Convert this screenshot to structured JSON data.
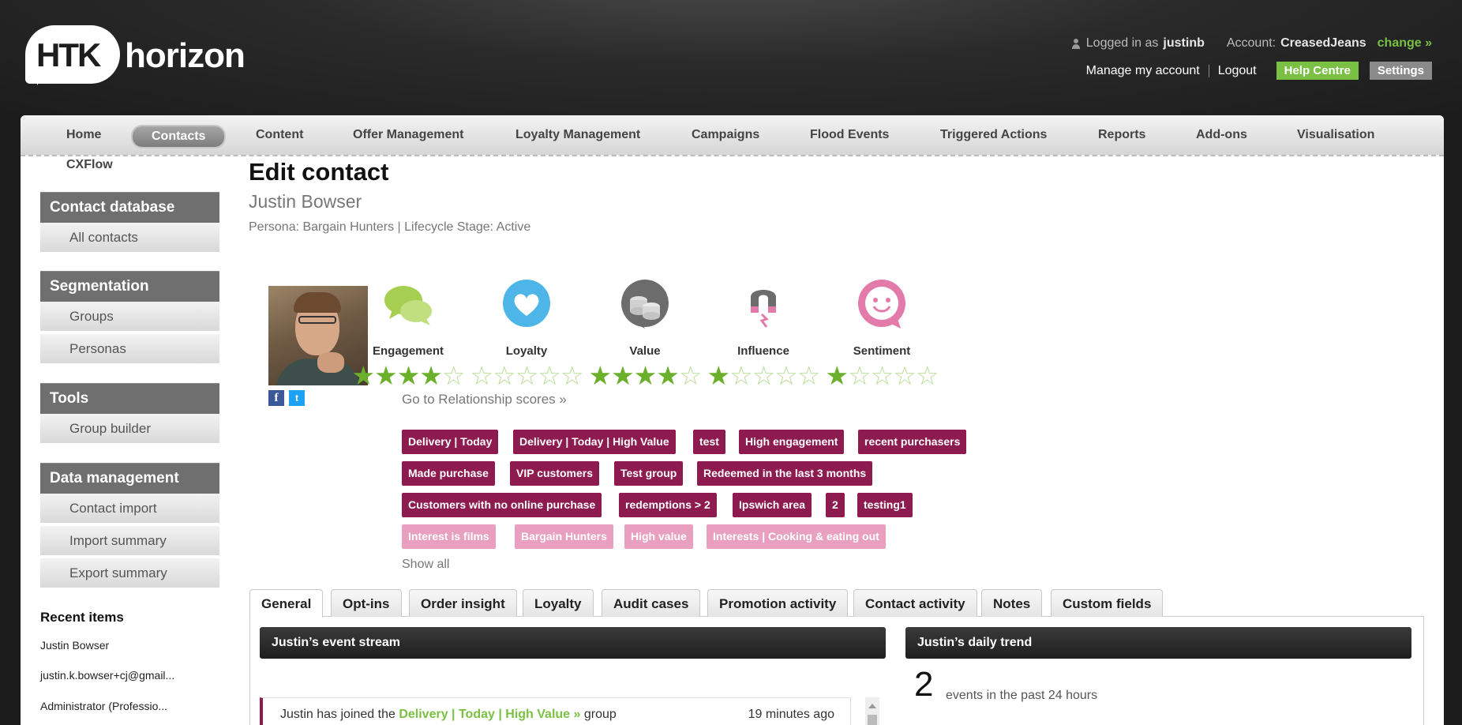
{
  "header": {
    "logo_htk": "HTK",
    "logo_horizon": "horizon",
    "logged_in_label": "Logged in as",
    "username": "justinb",
    "account_label": "Account:",
    "account_name": "CreasedJeans",
    "change_link": "change »",
    "manage_account": "Manage my account",
    "logout": "Logout",
    "help_centre": "Help Centre",
    "settings": "Settings"
  },
  "nav": {
    "items": [
      "Home",
      "Contacts",
      "Content",
      "Offer Management",
      "Loyalty Management",
      "Campaigns",
      "Flood Events",
      "Triggered Actions",
      "Reports",
      "Add-ons",
      "Visualisation",
      "CXFlow"
    ],
    "active": "Contacts"
  },
  "sidebar": {
    "sections": [
      {
        "title": "Contact database",
        "items": [
          "All contacts"
        ]
      },
      {
        "title": "Segmentation",
        "items": [
          "Groups",
          "Personas"
        ]
      },
      {
        "title": "Tools",
        "items": [
          "Group builder"
        ]
      },
      {
        "title": "Data management",
        "items": [
          "Contact import",
          "Import summary",
          "Export summary"
        ]
      }
    ],
    "recent_title": "Recent items",
    "recent_items": [
      "Justin Bowser",
      "justin.k.bowser+cj@gmail...",
      "Administrator (Professio..."
    ]
  },
  "contact": {
    "page_title": "Edit contact",
    "name": "Justin Bowser",
    "persona_line": "Persona: Bargain Hunters | Lifecycle Stage: Active"
  },
  "scores": [
    {
      "label": "Engagement",
      "stars": 4,
      "icon": "speech-bubbles-icon",
      "color": "#a6cf52"
    },
    {
      "label": "Loyalty",
      "stars": 0,
      "icon": "heart-icon",
      "color": "#4db5e8"
    },
    {
      "label": "Value",
      "stars": 4,
      "icon": "coins-icon",
      "color": "#6c6c6c"
    },
    {
      "label": "Influence",
      "stars": 1,
      "icon": "magnet-icon",
      "color": "#6c6c6c"
    },
    {
      "label": "Sentiment",
      "stars": 1,
      "icon": "smiley-icon",
      "color": "#e27aaa"
    }
  ],
  "relationship_link": "Go to Relationship scores »",
  "tags": [
    [
      "Delivery | Today",
      "Delivery | Today | High Value",
      "test",
      "High engagement",
      "recent purchasers"
    ],
    [
      "Made purchase",
      "VIP customers",
      "Test group",
      "Redeemed in the last 3 months"
    ],
    [
      "Customers with no online purchase",
      "redemptions > 2",
      "Ipswich area",
      "2",
      "testing1"
    ]
  ],
  "pink_tags": [
    "Interest is films",
    "Bargain Hunters",
    "High value",
    "Interests | Cooking & eating out"
  ],
  "show_all": "Show all",
  "tabs": [
    "General",
    "Opt-ins",
    "Order insight",
    "Loyalty",
    "Audit cases",
    "Promotion activity",
    "Contact activity",
    "Notes",
    "Custom fields"
  ],
  "active_tab": "General",
  "event_stream": {
    "title": "Justin’s event stream",
    "event_prefix": "Justin has joined the",
    "event_link": "Delivery | Today | High Value »",
    "event_suffix": "group",
    "event_time": "19 minutes ago"
  },
  "daily_trend": {
    "title": "Justin’s daily trend",
    "count": "2",
    "text": "events in the past 24 hours"
  }
}
